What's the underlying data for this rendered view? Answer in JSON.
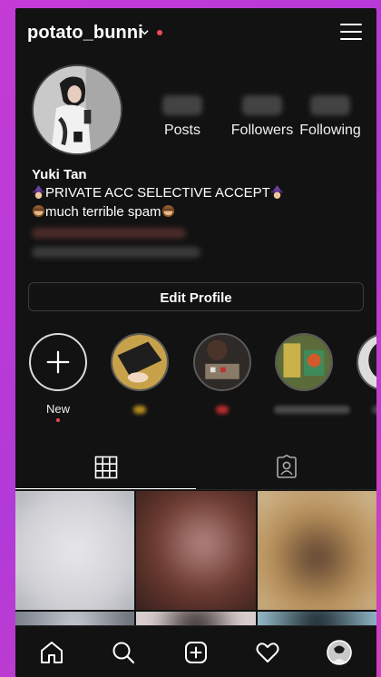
{
  "header": {
    "username": "potato_bunni",
    "icons": [
      "chevron-down-icon",
      "notification-dot",
      "menu-icon"
    ]
  },
  "profile": {
    "stats": [
      {
        "label": "Posts"
      },
      {
        "label": "Followers"
      },
      {
        "label": "Following"
      }
    ],
    "name": "Yuki Tan",
    "bio_line1": "PRIVATE ACC SELECTIVE ACCEPT",
    "bio_line2": "much terrible spam",
    "edit_button": "Edit Profile"
  },
  "highlights": {
    "new_label": "New",
    "items": [
      {
        "icon": "highlight-1"
      },
      {
        "icon": "highlight-2"
      },
      {
        "icon": "highlight-3"
      },
      {
        "icon": "highlight-4"
      }
    ]
  },
  "tabs": [
    "grid-icon",
    "tagged-icon"
  ],
  "bottom_nav": [
    "home-icon",
    "search-icon",
    "add-icon",
    "heart-icon",
    "profile-avatar"
  ],
  "colors": {
    "background": "#121212",
    "accent_dot": "#ed4956",
    "frame_gradient": "#c43bd6"
  }
}
